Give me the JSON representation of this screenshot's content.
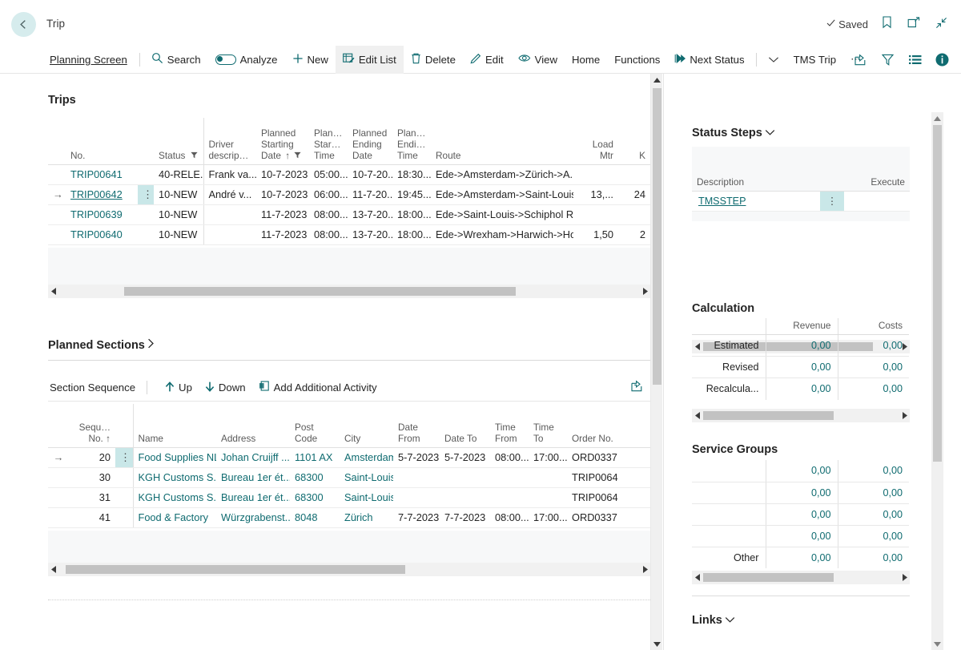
{
  "window": {
    "back_icon": "back-arrow-icon",
    "caption": "Trip",
    "saved_label": "Saved",
    "saved_check_icon": "check-icon",
    "top_icons": [
      "bookmark-icon",
      "open-in-new-window-icon",
      "collapse-icon"
    ]
  },
  "ribbon": {
    "items": [
      {
        "label": "Planning Screen",
        "icon": null,
        "style": "link"
      },
      {
        "label": "Search",
        "icon": "search-icon",
        "style": "normal"
      },
      {
        "label": "Analyze",
        "icon": "toggle-switch",
        "style": "normal"
      },
      {
        "label": "New",
        "icon": "plus-icon",
        "style": "normal"
      },
      {
        "label": "Edit List",
        "icon": "edit-list-icon",
        "style": "active"
      },
      {
        "label": "Delete",
        "icon": "trash-icon",
        "style": "normal"
      },
      {
        "label": "Edit",
        "icon": "pencil-icon",
        "style": "normal"
      },
      {
        "label": "View",
        "icon": "eye-icon",
        "style": "normal"
      },
      {
        "label": "Home",
        "icon": null,
        "style": "normal"
      },
      {
        "label": "Functions",
        "icon": null,
        "style": "normal"
      },
      {
        "label": "Next Status",
        "icon": "next-status-icon",
        "style": "normal"
      },
      {
        "label": "",
        "icon": "chevron-down-icon",
        "style": "normal"
      },
      {
        "label": "TMS Trip",
        "icon": null,
        "style": "normal"
      },
      {
        "label": "",
        "icon": "ellipsis-icon",
        "style": "normal"
      }
    ],
    "right_icons": [
      "share-icon",
      "filter-icon",
      "list-icon",
      "info-icon"
    ]
  },
  "trips": {
    "title": "Trips",
    "columns": [
      {
        "key": "no",
        "label": "No.",
        "align": "left"
      },
      {
        "key": "status",
        "label": "Status",
        "align": "left",
        "filter_icon": "filter-icon"
      },
      {
        "key": "driver",
        "label": "Driver descrip...",
        "align": "left"
      },
      {
        "key": "plan_start_date",
        "label": "Planned Starting Date",
        "align": "left",
        "sort_icon": "sort-asc-icon",
        "filter_icon": "filter-icon"
      },
      {
        "key": "plan_start_time",
        "label": "Plan... Star... Time",
        "align": "left"
      },
      {
        "key": "plan_end_date",
        "label": "Planned Ending Date",
        "align": "left"
      },
      {
        "key": "plan_end_time",
        "label": "Plan... Endi... Time",
        "align": "left"
      },
      {
        "key": "route",
        "label": "Route",
        "align": "left"
      },
      {
        "key": "load_mtr",
        "label": "Load Mtr",
        "align": "right"
      },
      {
        "key": "k",
        "label": "K",
        "align": "right"
      }
    ],
    "rows": [
      {
        "selected": false,
        "no": "TRIP00641",
        "status": "40-RELE...",
        "driver": "Frank va...",
        "plan_start_date": "10-7-2023",
        "plan_start_time": "05:00...",
        "plan_end_date": "10-7-20...",
        "plan_end_time": "18:30...",
        "route": "Ede->Amsterdam->Zürich->A...",
        "load_mtr": "",
        "k": ""
      },
      {
        "selected": true,
        "no": "TRIP00642",
        "status": "10-NEW",
        "driver": "André v...",
        "plan_start_date": "10-7-2023",
        "plan_start_time": "06:00...",
        "plan_end_date": "11-7-20...",
        "plan_end_time": "19:45...",
        "route": "Ede->Amsterdam->Saint-Louis...",
        "load_mtr": "13,...",
        "k": "24"
      },
      {
        "selected": false,
        "no": "TRIP00639",
        "status": "10-NEW",
        "driver": "",
        "plan_start_date": "11-7-2023",
        "plan_start_time": "08:00...",
        "plan_end_date": "13-7-20...",
        "plan_end_time": "18:00...",
        "route": "Ede->Saint-Louis->Schiphol Rij...",
        "load_mtr": "",
        "k": ""
      },
      {
        "selected": false,
        "no": "TRIP00640",
        "status": "10-NEW",
        "driver": "",
        "plan_start_date": "11-7-2023",
        "plan_start_time": "08:00...",
        "plan_end_date": "13-7-20...",
        "plan_end_time": "18:00...",
        "route": "Ede->Wrexham->Harwich->Ho...",
        "load_mtr": "1,50",
        "k": "2"
      }
    ]
  },
  "planned_sections": {
    "title": "Planned Sections",
    "expand_icon": "chevron-right-icon",
    "toolbar": {
      "label": "Section Sequence",
      "up_label": "Up",
      "up_icon": "arrow-up-icon",
      "down_label": "Down",
      "down_icon": "arrow-down-icon",
      "add_label": "Add Additional Activity",
      "add_icon": "add-activity-icon",
      "share_icon": "share-icon"
    },
    "columns": [
      {
        "key": "seq",
        "label": "Sequ... No.",
        "align": "right",
        "sort_icon": "sort-asc-icon"
      },
      {
        "key": "name",
        "label": "Name",
        "align": "left"
      },
      {
        "key": "address",
        "label": "Address",
        "align": "left"
      },
      {
        "key": "post_code",
        "label": "Post Code",
        "align": "left"
      },
      {
        "key": "city",
        "label": "City",
        "align": "left"
      },
      {
        "key": "date_from",
        "label": "Date From",
        "align": "left"
      },
      {
        "key": "date_to",
        "label": "Date To",
        "align": "left"
      },
      {
        "key": "time_from",
        "label": "Time From",
        "align": "left"
      },
      {
        "key": "time_to",
        "label": "Time To",
        "align": "left"
      },
      {
        "key": "order_no",
        "label": "Order No.",
        "align": "left"
      }
    ],
    "rows": [
      {
        "selected": true,
        "seq": "20",
        "name": "Food Supplies NL",
        "address": "Johan Cruijff ...",
        "post_code": "1101 AX",
        "city": "Amsterdam",
        "date_from": "5-7-2023",
        "date_to": "5-7-2023",
        "time_from": "08:00...",
        "time_to": "17:00...",
        "order_no": "ORD0337"
      },
      {
        "selected": false,
        "seq": "30",
        "name": "KGH Customs S...",
        "address": "Bureau 1er ét...",
        "post_code": "68300",
        "city": "Saint-Louis",
        "date_from": "",
        "date_to": "",
        "time_from": "",
        "time_to": "",
        "order_no": "TRIP0064"
      },
      {
        "selected": false,
        "seq": "31",
        "name": "KGH Customs S...",
        "address": "Bureau 1er ét...",
        "post_code": "68300",
        "city": "Saint-Louis",
        "date_from": "",
        "date_to": "",
        "time_from": "",
        "time_to": "",
        "order_no": "TRIP0064"
      },
      {
        "selected": false,
        "seq": "41",
        "name": "Food & Factory",
        "address": "Würzgrabenst...",
        "post_code": "8048",
        "city": "Zürich",
        "date_from": "7-7-2023",
        "date_to": "7-7-2023",
        "time_from": "08:00...",
        "time_to": "17:00...",
        "order_no": "ORD0337"
      }
    ]
  },
  "status_steps": {
    "title": "Status Steps",
    "collapse_icon": "chevron-down-icon",
    "columns": [
      {
        "key": "description",
        "label": "Description",
        "align": "left"
      },
      {
        "key": "executed",
        "label": "Execute",
        "align": "right"
      }
    ],
    "rows": [
      {
        "selected": true,
        "description": "TMSSTEP",
        "executed": ""
      }
    ]
  },
  "calculation": {
    "title": "Calculation",
    "columns": [
      "",
      "Revenue",
      "Costs"
    ],
    "rows": [
      {
        "label": "Estimated",
        "revenue": "0,00",
        "costs": "0,00"
      },
      {
        "label": "Revised",
        "revenue": "0,00",
        "costs": "0,00"
      },
      {
        "label": "Recalcula...",
        "revenue": "0,00",
        "costs": "0,00"
      }
    ]
  },
  "service_groups": {
    "title": "Service Groups",
    "rows": [
      {
        "label": "",
        "revenue": "0,00",
        "costs": "0,00"
      },
      {
        "label": "",
        "revenue": "0,00",
        "costs": "0,00"
      },
      {
        "label": "",
        "revenue": "0,00",
        "costs": "0,00"
      },
      {
        "label": "",
        "revenue": "0,00",
        "costs": "0,00"
      },
      {
        "label": "Other",
        "revenue": "0,00",
        "costs": "0,00"
      }
    ]
  },
  "links": {
    "title": "Links",
    "collapse_icon": "chevron-down-icon"
  },
  "colors": {
    "accent": "#0f6b70",
    "selection": "#c9e7e8",
    "back_circle": "#d6eced",
    "grid_line": "#ededed",
    "scroll_thumb": "#c2c2c2"
  }
}
